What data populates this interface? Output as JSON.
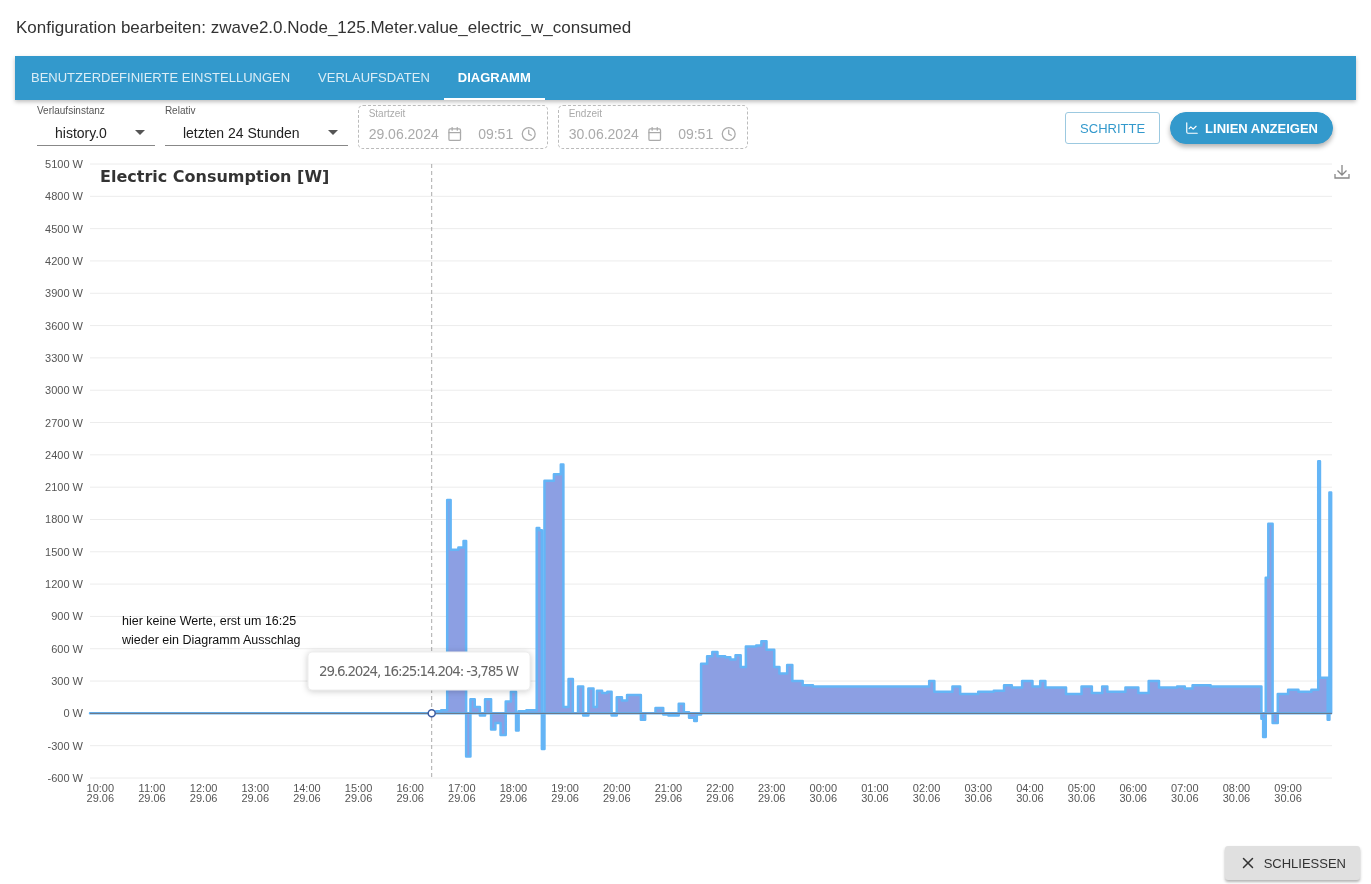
{
  "dialog": {
    "title": "Konfiguration bearbeiten: zwave2.0.Node_125.Meter.value_electric_w_consumed"
  },
  "tabs": [
    {
      "label": "BENUTZERDEFINIERTE EINSTELLUNGEN",
      "selected": false
    },
    {
      "label": "VERLAUFSDATEN",
      "selected": false
    },
    {
      "label": "DIAGRAMM",
      "selected": true
    }
  ],
  "controls": [
    {
      "kind": "select",
      "label": "Verlaufsinstanz",
      "value": "history.0"
    },
    {
      "kind": "select",
      "label": "Relativ",
      "value": "letzten 24 Stunden"
    },
    {
      "kind": "datetime",
      "label": "Startzeit",
      "date": "29.06.2024",
      "time": "09:51",
      "disabled": true
    },
    {
      "kind": "datetime",
      "label": "Endzeit",
      "date": "30.06.2024",
      "time": "09:51",
      "disabled": true
    }
  ],
  "buttons": [
    {
      "kind": "outlined",
      "label": "SCHRITTE"
    },
    {
      "kind": "contained",
      "label": "LINIEN ANZEIGEN"
    }
  ],
  "chart": {
    "note": "hier keine Werte, erst um 16:25\nwieder ein Diagramm Ausschlag",
    "tooltip": {
      "text": "29.6.2024, 16:25:14.204: -3,785 W"
    },
    "chart_data": {
      "type": "area",
      "title": "Electric Consumption [W]",
      "xlim": [
        "2024-06-29T09:48",
        "2024-06-30T09:51"
      ],
      "ylim": [
        -600,
        5100
      ],
      "x": [
        "2024-06-29T09:48",
        "2024-06-29T16:25",
        "2024-06-29T16:30",
        "2024-06-29T16:36",
        "2024-06-29T16:43",
        "2024-06-29T16:47",
        "2024-06-29T16:56",
        "2024-06-29T17:02",
        "2024-06-29T17:05",
        "2024-06-29T17:10",
        "2024-06-29T17:15",
        "2024-06-29T17:21",
        "2024-06-29T17:27",
        "2024-06-29T17:34",
        "2024-06-29T17:39",
        "2024-06-29T17:45",
        "2024-06-29T17:51",
        "2024-06-29T17:57",
        "2024-06-29T18:03",
        "2024-06-29T18:06",
        "2024-06-29T18:15",
        "2024-06-29T18:27",
        "2024-06-29T18:30",
        "2024-06-29T18:33",
        "2024-06-29T18:36",
        "2024-06-29T18:47",
        "2024-06-29T18:55",
        "2024-06-29T18:58",
        "2024-06-29T19:04",
        "2024-06-29T19:09",
        "2024-06-29T19:15",
        "2024-06-29T19:21",
        "2024-06-29T19:27",
        "2024-06-29T19:33",
        "2024-06-29T19:37",
        "2024-06-29T19:43",
        "2024-06-29T19:49",
        "2024-06-29T19:54",
        "2024-06-29T20:00",
        "2024-06-29T20:06",
        "2024-06-29T20:12",
        "2024-06-29T20:21",
        "2024-06-29T20:28",
        "2024-06-29T20:33",
        "2024-06-29T20:45",
        "2024-06-29T20:54",
        "2024-06-29T21:00",
        "2024-06-29T21:12",
        "2024-06-29T21:18",
        "2024-06-29T21:24",
        "2024-06-29T21:30",
        "2024-06-29T21:33",
        "2024-06-29T21:38",
        "2024-06-29T21:45",
        "2024-06-29T21:51",
        "2024-06-29T21:57",
        "2024-06-29T22:06",
        "2024-06-29T22:12",
        "2024-06-29T22:18",
        "2024-06-29T22:24",
        "2024-06-29T22:30",
        "2024-06-29T22:42",
        "2024-06-29T22:48",
        "2024-06-29T22:54",
        "2024-06-29T23:03",
        "2024-06-29T23:09",
        "2024-06-29T23:18",
        "2024-06-29T23:24",
        "2024-06-29T23:36",
        "2024-06-29T23:48",
        "2024-06-30T02:03",
        "2024-06-30T02:09",
        "2024-06-30T02:30",
        "2024-06-30T02:39",
        "2024-06-30T03:00",
        "2024-06-30T03:18",
        "2024-06-30T03:30",
        "2024-06-30T03:39",
        "2024-06-30T03:51",
        "2024-06-30T04:03",
        "2024-06-30T04:12",
        "2024-06-30T04:18",
        "2024-06-30T04:42",
        "2024-06-30T05:00",
        "2024-06-30T05:12",
        "2024-06-30T05:24",
        "2024-06-30T05:30",
        "2024-06-30T05:51",
        "2024-06-30T06:06",
        "2024-06-30T06:18",
        "2024-06-30T06:30",
        "2024-06-30T06:51",
        "2024-06-30T07:00",
        "2024-06-30T07:09",
        "2024-06-30T07:30",
        "2024-06-30T08:29",
        "2024-06-30T08:31",
        "2024-06-30T08:34",
        "2024-06-30T08:37",
        "2024-06-30T08:42",
        "2024-06-30T08:48",
        "2024-06-30T09:00",
        "2024-06-30T09:12",
        "2024-06-30T09:27",
        "2024-06-30T09:35",
        "2024-06-30T09:37",
        "2024-06-30T09:46",
        "2024-06-30T09:48",
        "2024-06-30T09:50"
      ],
      "series": [
        {
          "color": "#64b5f6",
          "values": [
            0,
            0,
            20,
            30,
            1980,
            1520,
            1540,
            1600,
            -400,
            130,
            60,
            -20,
            130,
            -150,
            -90,
            -200,
            110,
            200,
            -160,
            20,
            30,
            1720,
            1700,
            -330,
            2160,
            2220,
            2310,
            60,
            320,
            0,
            250,
            -20,
            230,
            60,
            210,
            190,
            200,
            -20,
            150,
            120,
            170,
            170,
            -60,
            0,
            50,
            -10,
            -20,
            90,
            10,
            -40,
            -70,
            -10,
            460,
            530,
            570,
            530,
            520,
            500,
            540,
            430,
            620,
            630,
            670,
            590,
            430,
            370,
            450,
            300,
            260,
            250,
            300,
            200,
            250,
            180,
            200,
            210,
            260,
            240,
            300,
            250,
            300,
            240,
            180,
            250,
            190,
            250,
            200,
            240,
            190,
            300,
            240,
            250,
            230,
            260,
            250,
            -50,
            -220,
            1260,
            1760,
            -90,
            180,
            220,
            200,
            220,
            2340,
            330,
            -60,
            2050,
            2050
          ]
        }
      ],
      "yticks": [
        {
          "value": -600,
          "label": "-600 W"
        },
        {
          "value": -300,
          "label": "-300 W"
        },
        {
          "value": 0,
          "label": "0 W"
        },
        {
          "value": 300,
          "label": "300 W"
        },
        {
          "value": 600,
          "label": "600 W"
        },
        {
          "value": 900,
          "label": "900 W"
        },
        {
          "value": 1200,
          "label": "1200 W"
        },
        {
          "value": 1500,
          "label": "1500 W"
        },
        {
          "value": 1800,
          "label": "1800 W"
        },
        {
          "value": 2100,
          "label": "2100 W"
        },
        {
          "value": 2400,
          "label": "2400 W"
        },
        {
          "value": 2700,
          "label": "2700 W"
        },
        {
          "value": 3000,
          "label": "3000 W"
        },
        {
          "value": 3300,
          "label": "3300 W"
        },
        {
          "value": 3600,
          "label": "3600 W"
        },
        {
          "value": 3900,
          "label": "3900 W"
        },
        {
          "value": 4200,
          "label": "4200 W"
        },
        {
          "value": 4500,
          "label": "4500 W"
        },
        {
          "value": 4800,
          "label": "4800 W"
        },
        {
          "value": 5100,
          "label": "5100 W"
        }
      ],
      "grid": true,
      "ref_lines": [
        {
          "axis": "x",
          "value": "2024-06-29T16:25"
        }
      ],
      "xticks": [
        {
          "value": "2024-06-29T10:00",
          "label": "10:00"
        },
        {
          "value": "2024-06-29T11:00",
          "label": "11:00"
        },
        {
          "value": "2024-06-29T12:00",
          "label": "12:00"
        },
        {
          "value": "2024-06-29T13:00",
          "label": "13:00"
        },
        {
          "value": "2024-06-29T14:00",
          "label": "14:00"
        },
        {
          "value": "2024-06-29T15:00",
          "label": "15:00"
        },
        {
          "value": "2024-06-29T16:00",
          "label": "16:00"
        },
        {
          "value": "2024-06-29T17:00",
          "label": "17:00"
        },
        {
          "value": "2024-06-29T18:00",
          "label": "18:00"
        },
        {
          "value": "2024-06-29T19:00",
          "label": "19:00"
        },
        {
          "value": "2024-06-29T20:00",
          "label": "20:00"
        },
        {
          "value": "2024-06-29T21:00",
          "label": "21:00"
        },
        {
          "value": "2024-06-29T22:00",
          "label": "22:00"
        },
        {
          "value": "2024-06-29T23:00",
          "label": "23:00"
        },
        {
          "value": "2024-06-30T00:00",
          "label": "00:00"
        },
        {
          "value": "2024-06-30T01:00",
          "label": "01:00"
        },
        {
          "value": "2024-06-30T02:00",
          "label": "02:00"
        },
        {
          "value": "2024-06-30T03:00",
          "label": "03:00"
        },
        {
          "value": "2024-06-30T04:00",
          "label": "04:00"
        },
        {
          "value": "2024-06-30T05:00",
          "label": "05:00"
        },
        {
          "value": "2024-06-30T06:00",
          "label": "06:00"
        },
        {
          "value": "2024-06-30T07:00",
          "label": "07:00"
        },
        {
          "value": "2024-06-30T08:00",
          "label": "08:00"
        },
        {
          "value": "2024-06-30T09:00",
          "label": "09:00"
        }
      ]
    },
    "x_dates": [
      "29.06",
      "29.06",
      "29.06",
      "29.06",
      "29.06",
      "29.06",
      "29.06",
      "29.06",
      "29.06",
      "29.06",
      "29.06",
      "29.06",
      "29.06",
      "29.06",
      "30.06",
      "30.06",
      "30.06",
      "30.06",
      "30.06",
      "30.06",
      "30.06",
      "30.06",
      "30.06",
      "30.06"
    ]
  },
  "footer": {
    "close_button": "SCHLIESSEN"
  }
}
